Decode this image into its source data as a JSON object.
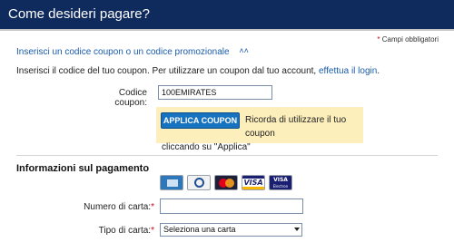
{
  "header": {
    "title": "Come desideri pagare?"
  },
  "required_note": {
    "star": "*",
    "text": " Campi obbligatori"
  },
  "coupon": {
    "toggle_link": "Inserisci un codice coupon o un codice promozionale",
    "toggle_icon": "chevron-up-icon",
    "info_text": "Inserisci il codice del tuo coupon. Per utilizzare un coupon dal tuo account, ",
    "login_link": "effettua il login",
    "info_end": ".",
    "label": "Codice coupon:",
    "value": "100EMIRATES",
    "apply_button": "APPLICA COUPON",
    "apply_hint_1": "Ricorda di utilizzare il tuo coupon",
    "apply_hint_2": "cliccando su \"Applica\""
  },
  "payment": {
    "title": "Informazioni sul pagamento",
    "card_icons": [
      "amex-icon",
      "diners-icon",
      "mastercard-icon",
      "visa-icon",
      "visa-electron-icon"
    ],
    "visa_text": "VISA",
    "electron_text_1": "VISA",
    "electron_text_2": "Electron",
    "card_number_label": "Numero di carta:",
    "card_number_star": "*",
    "card_number_value": "",
    "card_type_label": "Tipo di carta:",
    "card_type_star": "*",
    "card_type_selected": "Seleziona una carta"
  },
  "colors": {
    "header_bg": "#0f2a5c",
    "link": "#1a5ba8",
    "button": "#1773c0",
    "hint_bg": "#fcefbc",
    "required": "#d0021b"
  }
}
